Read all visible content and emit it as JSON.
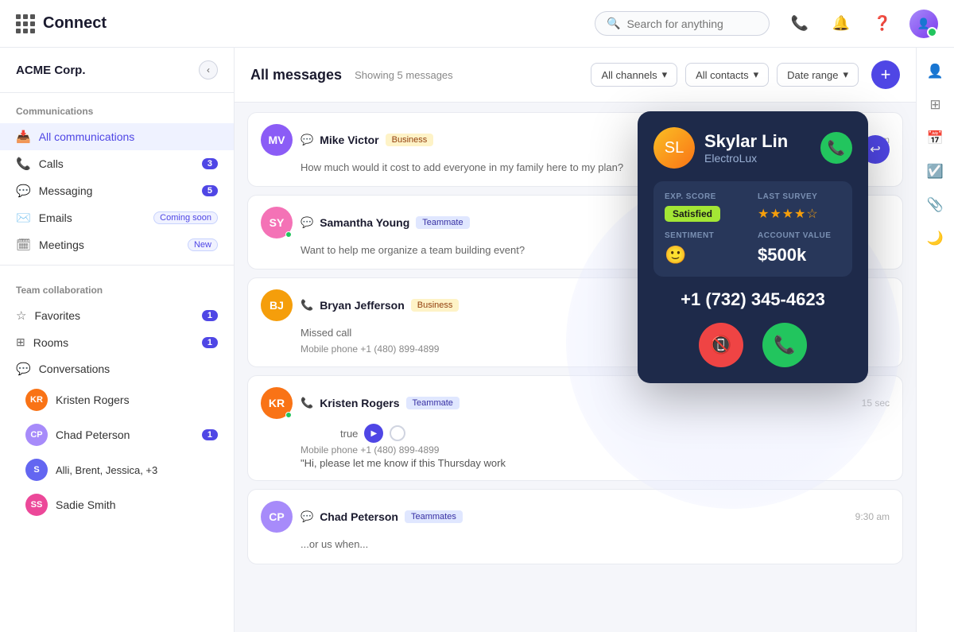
{
  "app": {
    "title": "Connect",
    "org": "ACME Corp."
  },
  "search": {
    "placeholder": "Search for anything"
  },
  "sidebar": {
    "communications_label": "Communications",
    "items": [
      {
        "id": "all-comms",
        "label": "All communications",
        "icon": "📥",
        "active": true,
        "badge": null
      },
      {
        "id": "calls",
        "label": "Calls",
        "icon": "📞",
        "badge": "3"
      },
      {
        "id": "messaging",
        "label": "Messaging",
        "icon": "💬",
        "badge": "5"
      },
      {
        "id": "emails",
        "label": "Emails",
        "icon": "✉️",
        "badge_text": "Coming soon"
      },
      {
        "id": "meetings",
        "label": "Meetings",
        "icon": "🗓",
        "badge_text": "New"
      }
    ],
    "team_label": "Team collaboration",
    "team_items": [
      {
        "id": "favorites",
        "label": "Favorites",
        "icon": "☆",
        "badge": "1"
      },
      {
        "id": "rooms",
        "label": "Rooms",
        "icon": "⊞",
        "badge": "1"
      },
      {
        "id": "conversations",
        "label": "Conversations",
        "icon": "💬"
      }
    ],
    "conversations": [
      {
        "name": "Kristen Rogers",
        "color": "#f97316"
      },
      {
        "name": "Chad Peterson",
        "color": "#a78bfa",
        "badge": "1"
      },
      {
        "name": "Alli, Brent, Jessica, +3",
        "color": "#6366f1"
      },
      {
        "name": "Sadie Smith",
        "color": "#ec4899"
      }
    ]
  },
  "content": {
    "title": "All messages",
    "subtitle": "Showing 5 messages",
    "filters": [
      {
        "label": "All channels"
      },
      {
        "label": "All contacts"
      },
      {
        "label": "Date range"
      }
    ],
    "messages": [
      {
        "id": "msg1",
        "avatar_initials": "MV",
        "avatar_color": "#8b5cf6",
        "name": "Mike Victor",
        "tag": "Business",
        "tag_type": "business",
        "channel": "chat",
        "time": "9:30 am",
        "preview": "How much would it cost to add everyone in my family here to my plan?",
        "has_reply": true
      },
      {
        "id": "msg2",
        "avatar_initials": "SY",
        "avatar_color": "#f472b6",
        "name": "Samantha Young",
        "tag": "Teammate",
        "tag_type": "teammate",
        "channel": "chat",
        "time": "",
        "preview": "Want to help me organize a team building event?",
        "has_reply": false,
        "online": true
      },
      {
        "id": "msg3",
        "avatar_initials": "BJ",
        "avatar_color": "#f59e0b",
        "name": "Bryan Jefferson",
        "tag": "Business",
        "tag_type": "business",
        "channel": "phone",
        "time": "",
        "missed_call": true,
        "phone": "Mobile phone +1 (480) 899-4899",
        "preview": "Missed call",
        "has_reply": false
      },
      {
        "id": "msg4",
        "avatar_initials": "KR",
        "avatar_color": "#f97316",
        "name": "Kristen Rogers",
        "tag": "Teammate",
        "tag_type": "teammate",
        "channel": "phone",
        "time": "15 sec",
        "missed_call_voicemail": true,
        "phone": "Mobile phone +1 (480) 899-4899",
        "voicemail_text": "\"Hi, please let me know if this Thursday work",
        "online": true
      },
      {
        "id": "msg5",
        "avatar_initials": "CP",
        "avatar_color": "#a78bfa",
        "name": "Chad Peterson",
        "tag": "Teammates",
        "tag_type": "teammates",
        "channel": "chat",
        "time": "9:30 am",
        "preview": "...or us when...",
        "has_reply": false
      }
    ]
  },
  "call_popup": {
    "caller_name": "Skylar Lin",
    "caller_company": "ElectroLux",
    "exp_label": "EXP. SCORE",
    "exp_value": "Satisfied",
    "survey_label": "LAST SURVEY",
    "stars": 3.5,
    "sentiment_label": "SENTIMENT",
    "sentiment_emoji": "🙂",
    "account_label": "ACCOUNT VALUE",
    "account_value": "$500k",
    "phone": "+1 (732) 345-4623"
  }
}
